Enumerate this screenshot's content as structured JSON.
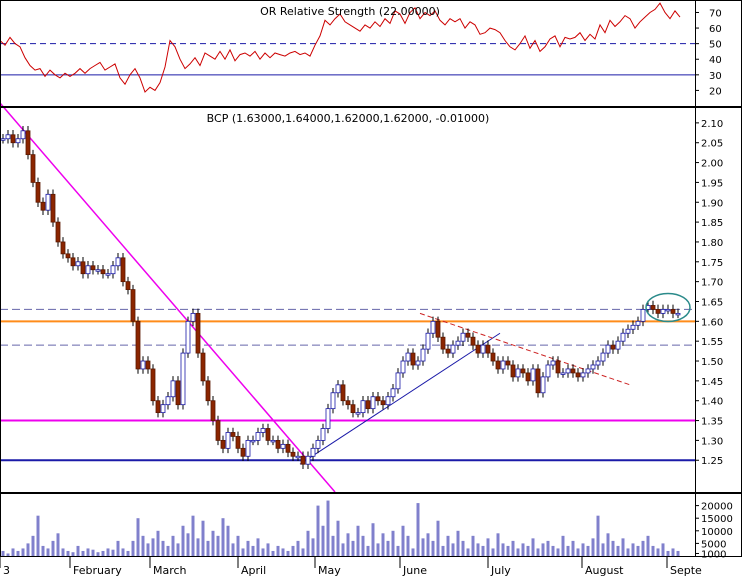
{
  "chart_data": [
    {
      "type": "line",
      "panel": "rsi",
      "title": "OR Relative Strength (22.00000)",
      "ylim": [
        10,
        78
      ],
      "yticks": [
        20,
        30,
        40,
        50,
        60,
        70
      ],
      "reference_lines": [
        {
          "value": 50,
          "style": "dashed"
        },
        {
          "value": 30,
          "style": "solid"
        }
      ],
      "series": [
        {
          "color": "#cc0000",
          "x": [
            0,
            5,
            10,
            15,
            20,
            25,
            30,
            35,
            40,
            45,
            50,
            55,
            60,
            65,
            70,
            75,
            80,
            85,
            90,
            95,
            100,
            105,
            110,
            115,
            120,
            125,
            130,
            135,
            140,
            145,
            150,
            155,
            160,
            165,
            170,
            175,
            180,
            185,
            190,
            195,
            200,
            205,
            210,
            215,
            220,
            225,
            230,
            235,
            240,
            245,
            250,
            255,
            260,
            265,
            270,
            275,
            280,
            285,
            290,
            295,
            300,
            305,
            310,
            315,
            320,
            325,
            330,
            335,
            340,
            345,
            350,
            355,
            360,
            365,
            370,
            375,
            380,
            385,
            390,
            395,
            400,
            405,
            410,
            415,
            420,
            425,
            430,
            435,
            440,
            445,
            450,
            455,
            460,
            465,
            470,
            475,
            480,
            485,
            490,
            495,
            500,
            505,
            510,
            515,
            520,
            525,
            530,
            535,
            540,
            545,
            550,
            555,
            560,
            565,
            570,
            575,
            580,
            585,
            590,
            595,
            600,
            605,
            610,
            615,
            620,
            625,
            630,
            635,
            640,
            645,
            650,
            655,
            660,
            665,
            670,
            675,
            680
          ],
          "values": [
            52,
            49,
            54,
            50,
            48,
            41,
            36,
            33,
            34,
            29,
            33,
            30,
            28,
            31,
            29,
            31,
            34,
            31,
            34,
            36,
            38,
            33,
            35,
            37,
            28,
            24,
            30,
            34,
            28,
            19,
            22,
            20,
            25,
            35,
            52,
            48,
            40,
            34,
            37,
            41,
            36,
            44,
            42,
            40,
            45,
            40,
            46,
            39,
            43,
            44,
            42,
            45,
            40,
            44,
            41,
            44,
            43,
            42,
            44,
            45,
            43,
            44,
            42,
            49,
            55,
            65,
            62,
            66,
            69,
            64,
            62,
            60,
            58,
            62,
            60,
            64,
            61,
            66,
            63,
            71,
            69,
            63,
            70,
            73,
            66,
            70,
            68,
            71,
            65,
            62,
            66,
            64,
            66,
            60,
            64,
            62,
            56,
            57,
            60,
            59,
            57,
            52,
            48,
            46,
            50,
            55,
            47,
            52,
            45,
            48,
            53,
            55,
            48,
            54,
            53,
            54,
            57,
            52,
            56,
            53,
            62,
            57,
            65,
            61,
            64,
            68,
            66,
            60,
            64,
            67,
            70,
            72,
            76,
            70,
            66,
            71,
            67
          ]
        }
      ],
      "xlabel": "",
      "ylabel": ""
    },
    {
      "type": "candlestick",
      "panel": "price",
      "title": "BCP (1.63000,1.64000,1.62000,1.62000, -0.01000)",
      "ylim": [
        1.17,
        2.14
      ],
      "yticks": [
        1.25,
        1.3,
        1.35,
        1.4,
        1.45,
        1.5,
        1.55,
        1.6,
        1.65,
        1.7,
        1.75,
        1.8,
        1.85,
        1.9,
        1.95,
        2.0,
        2.05,
        2.1
      ],
      "x_labels": [
        {
          "x": 0,
          "label": "3"
        },
        {
          "x": 70,
          "label": "February"
        },
        {
          "x": 150,
          "label": "March"
        },
        {
          "x": 238,
          "label": "April"
        },
        {
          "x": 315,
          "label": "May"
        },
        {
          "x": 400,
          "label": "June"
        },
        {
          "x": 488,
          "label": "July"
        },
        {
          "x": 582,
          "label": "August"
        },
        {
          "x": 667,
          "label": "Septe"
        }
      ],
      "candles_x": [
        3,
        8,
        13,
        18,
        23,
        28,
        33,
        38,
        43,
        48,
        53,
        58,
        63,
        68,
        73,
        78,
        83,
        88,
        93,
        98,
        103,
        108,
        113,
        118,
        123,
        128,
        133,
        138,
        143,
        148,
        153,
        158,
        163,
        168,
        173,
        178,
        183,
        188,
        193,
        198,
        203,
        208,
        213,
        218,
        223,
        228,
        233,
        238,
        243,
        248,
        253,
        258,
        263,
        268,
        273,
        278,
        283,
        288,
        293,
        298,
        303,
        308,
        313,
        318,
        323,
        328,
        333,
        338,
        343,
        348,
        353,
        358,
        363,
        368,
        373,
        378,
        383,
        388,
        393,
        398,
        403,
        408,
        413,
        418,
        423,
        428,
        433,
        438,
        443,
        448,
        453,
        458,
        463,
        468,
        473,
        478,
        483,
        488,
        493,
        498,
        503,
        508,
        513,
        518,
        523,
        528,
        533,
        538,
        543,
        548,
        553,
        558,
        563,
        568,
        573,
        578,
        583,
        588,
        593,
        598,
        603,
        608,
        613,
        618,
        623,
        628,
        633,
        638,
        643,
        648,
        653,
        658,
        663,
        668,
        673,
        678
      ],
      "close": [
        2.06,
        2.07,
        2.05,
        2.06,
        2.08,
        2.02,
        1.95,
        1.9,
        1.88,
        1.92,
        1.85,
        1.8,
        1.77,
        1.76,
        1.74,
        1.75,
        1.72,
        1.74,
        1.73,
        1.73,
        1.72,
        1.72,
        1.74,
        1.76,
        1.7,
        1.68,
        1.6,
        1.48,
        1.5,
        1.48,
        1.4,
        1.37,
        1.39,
        1.41,
        1.45,
        1.39,
        1.52,
        1.6,
        1.62,
        1.52,
        1.45,
        1.4,
        1.35,
        1.3,
        1.28,
        1.32,
        1.31,
        1.28,
        1.26,
        1.3,
        1.3,
        1.32,
        1.33,
        1.3,
        1.3,
        1.28,
        1.29,
        1.27,
        1.26,
        1.26,
        1.24,
        1.26,
        1.28,
        1.3,
        1.33,
        1.38,
        1.42,
        1.44,
        1.4,
        1.39,
        1.37,
        1.37,
        1.4,
        1.38,
        1.41,
        1.4,
        1.39,
        1.41,
        1.43,
        1.47,
        1.5,
        1.52,
        1.49,
        1.5,
        1.53,
        1.57,
        1.6,
        1.56,
        1.53,
        1.52,
        1.54,
        1.55,
        1.57,
        1.56,
        1.54,
        1.52,
        1.54,
        1.52,
        1.5,
        1.48,
        1.5,
        1.49,
        1.46,
        1.48,
        1.47,
        1.45,
        1.48,
        1.42,
        1.46,
        1.49,
        1.5,
        1.47,
        1.47,
        1.48,
        1.47,
        1.46,
        1.47,
        1.48,
        1.49,
        1.5,
        1.52,
        1.54,
        1.53,
        1.55,
        1.57,
        1.58,
        1.59,
        1.6,
        1.63,
        1.64,
        1.63,
        1.62,
        1.63,
        1.63,
        1.62,
        1.62
      ],
      "horizontal_lines": [
        {
          "value": 1.63,
          "color": "#6666aa",
          "style": "dashed"
        },
        {
          "value": 1.6,
          "color": "#ff8c1a",
          "style": "solid"
        },
        {
          "value": 1.54,
          "color": "#6666aa",
          "style": "dashed"
        },
        {
          "value": 1.35,
          "color": "#ee00ee",
          "style": "solid"
        },
        {
          "value": 1.25,
          "color": "#1a1aa8",
          "style": "solid"
        }
      ],
      "trendlines": [
        {
          "color": "#ee00ee",
          "from": {
            "x": 0,
            "y": 2.15
          },
          "to": {
            "x": 335,
            "y": 1.17
          }
        },
        {
          "color": "#1a1aa8",
          "from": {
            "x": 300,
            "y": 1.24
          },
          "to": {
            "x": 500,
            "y": 1.57
          }
        },
        {
          "color": "#cc2222",
          "from": {
            "x": 420,
            "y": 1.62
          },
          "to": {
            "x": 630,
            "y": 1.44
          }
        }
      ],
      "xlabel": "",
      "ylabel": ""
    },
    {
      "type": "bar",
      "panel": "volume",
      "ylim": [
        0,
        25000
      ],
      "yticks": [
        1000,
        5000,
        10000,
        15000,
        20000
      ],
      "color": "#8080cc",
      "x": [
        3,
        8,
        13,
        18,
        23,
        28,
        33,
        38,
        43,
        48,
        53,
        58,
        63,
        68,
        73,
        78,
        83,
        88,
        93,
        98,
        103,
        108,
        113,
        118,
        123,
        128,
        133,
        138,
        143,
        148,
        153,
        158,
        163,
        168,
        173,
        178,
        183,
        188,
        193,
        198,
        203,
        208,
        213,
        218,
        223,
        228,
        233,
        238,
        243,
        248,
        253,
        258,
        263,
        268,
        273,
        278,
        283,
        288,
        293,
        298,
        303,
        308,
        313,
        318,
        323,
        328,
        333,
        338,
        343,
        348,
        353,
        358,
        363,
        368,
        373,
        378,
        383,
        388,
        393,
        398,
        403,
        408,
        413,
        418,
        423,
        428,
        433,
        438,
        443,
        448,
        453,
        458,
        463,
        468,
        473,
        478,
        483,
        488,
        493,
        498,
        503,
        508,
        513,
        518,
        523,
        528,
        533,
        538,
        543,
        548,
        553,
        558,
        563,
        568,
        573,
        578,
        583,
        588,
        593,
        598,
        603,
        608,
        613,
        618,
        623,
        628,
        633,
        638,
        643,
        648,
        653,
        658,
        663,
        668,
        673,
        678
      ],
      "values": [
        2000,
        1000,
        3000,
        2000,
        3000,
        5000,
        8000,
        16000,
        4000,
        3000,
        6000,
        9000,
        3000,
        2000,
        1500,
        4000,
        2000,
        3000,
        2500,
        1500,
        2000,
        3000,
        2500,
        6000,
        3000,
        2000,
        6000,
        15000,
        8000,
        5000,
        7000,
        10000,
        6000,
        4000,
        8000,
        5000,
        12000,
        9000,
        16000,
        7000,
        14000,
        6000,
        10000,
        8000,
        15000,
        12000,
        5000,
        8000,
        3000,
        6000,
        4000,
        7000,
        3000,
        5000,
        2000,
        4000,
        3000,
        2000,
        4000,
        6000,
        3000,
        10000,
        7000,
        20000,
        12000,
        22000,
        8000,
        14000,
        5000,
        9000,
        6000,
        12000,
        8000,
        4000,
        13000,
        5000,
        9000,
        6000,
        10000,
        4000,
        12000,
        8000,
        3000,
        21000,
        7000,
        9000,
        6000,
        14000,
        4000,
        8000,
        5000,
        10000,
        6000,
        3000,
        8000,
        5000,
        4000,
        7000,
        3000,
        9000,
        5000,
        4000,
        6000,
        3000,
        5000,
        4000,
        7000,
        3000,
        5000,
        6000,
        4000,
        3000,
        8000,
        4000,
        6000,
        3000,
        5000,
        4000,
        7000,
        16000,
        5000,
        9000,
        6000,
        4000,
        7000,
        3000,
        5000,
        4000,
        6000,
        8000,
        4000,
        3000,
        5000,
        2000,
        3000,
        2000
      ]
    }
  ]
}
